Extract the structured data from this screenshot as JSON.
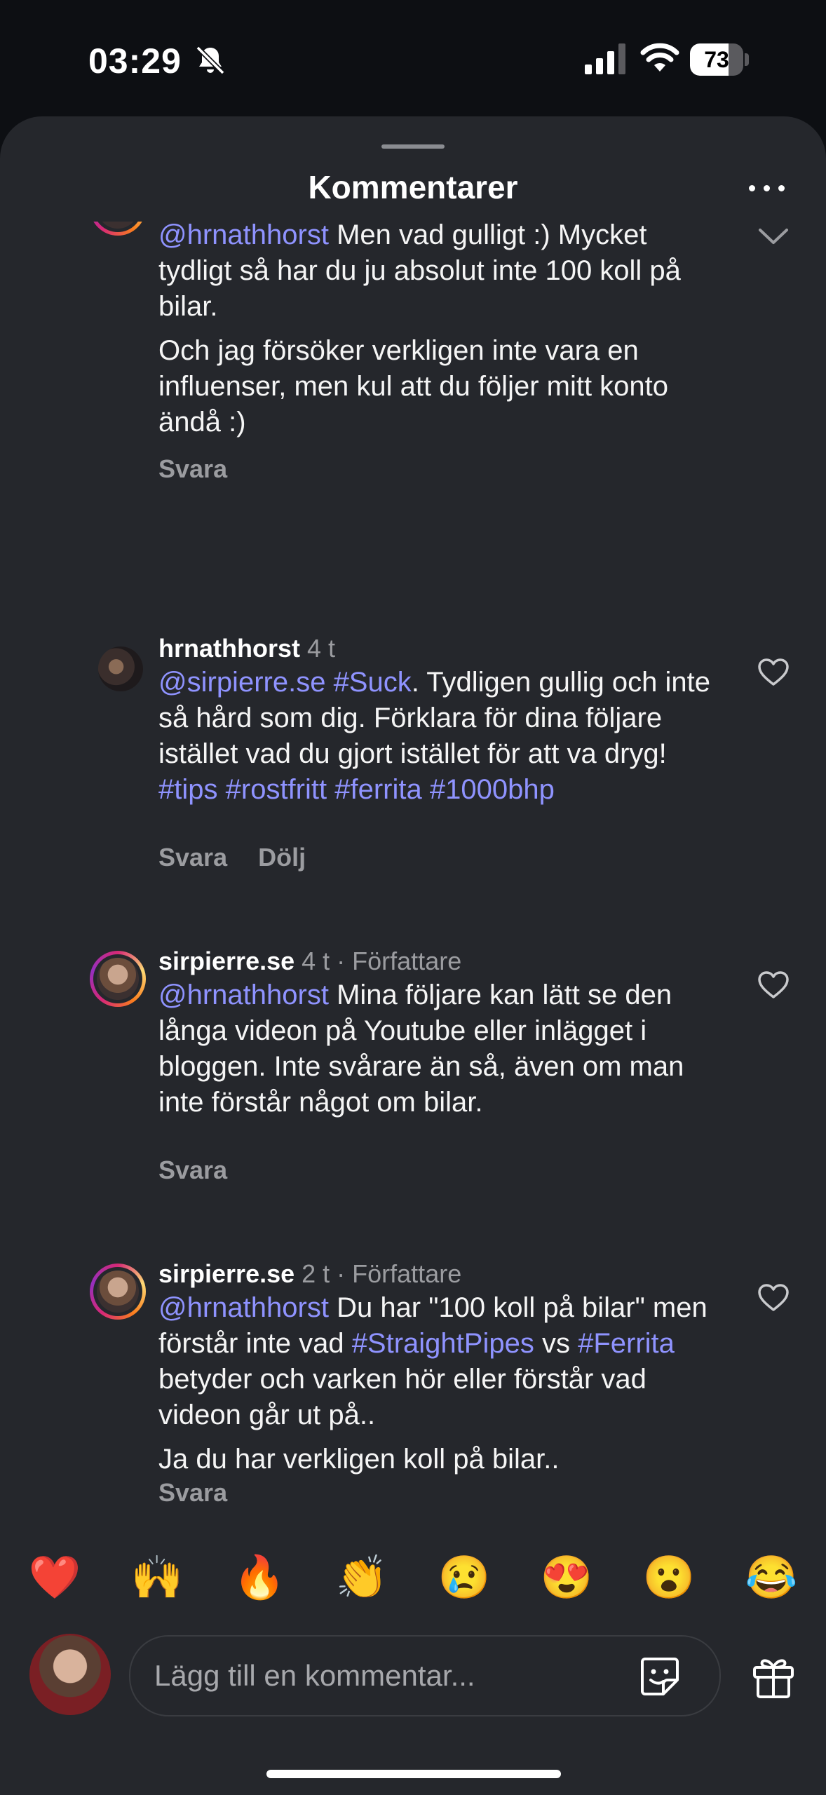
{
  "status_bar": {
    "time": "03:29",
    "battery": "73",
    "battery_level": 0.73
  },
  "sheet": {
    "title": "Kommentarer"
  },
  "comments": [
    {
      "partial": true,
      "paragraphs": [
        [
          {
            "t": "@hrnathhorst",
            "link": true
          },
          {
            "t": " Men vad gulligt :) Mycket tydligt så har du ju absolut inte 100 koll på bilar.",
            "link": false
          }
        ],
        [
          {
            "t": "Och jag försöker verkligen inte vara en influenser, men kul att du följer mitt konto ändå :)",
            "link": false
          }
        ]
      ],
      "actions": [
        "Svara"
      ]
    },
    {
      "username": "hrnathhorst",
      "meta": " 4 t",
      "paragraphs": [
        [
          {
            "t": "@sirpierre.se",
            "link": true
          },
          {
            "t": " ",
            "link": false
          },
          {
            "t": "#Suck",
            "link": true
          },
          {
            "t": ". Tydligen gullig och inte så hård som dig. Förklara för dina följare istället vad du gjort istället för att va dryg! ",
            "link": false
          },
          {
            "t": "#tips",
            "link": true
          },
          {
            "t": " ",
            "link": false
          },
          {
            "t": "#rostfritt",
            "link": true
          },
          {
            "t": " ",
            "link": false
          },
          {
            "t": "#ferrita",
            "link": true
          },
          {
            "t": " ",
            "link": false
          },
          {
            "t": "#1000bhp",
            "link": true
          }
        ]
      ],
      "actions": [
        "Svara",
        "Dölj"
      ]
    },
    {
      "username": "sirpierre.se",
      "meta": " 4 t · Författare",
      "paragraphs": [
        [
          {
            "t": "@hrnathhorst",
            "link": true
          },
          {
            "t": " Mina följare kan lätt se den långa videon på Youtube eller inlägget i bloggen. Inte svårare än så, även om man inte förstår något om bilar.",
            "link": false
          }
        ]
      ],
      "actions": [
        "Svara"
      ]
    },
    {
      "username": "sirpierre.se",
      "meta": " 2 t · Författare",
      "paragraphs": [
        [
          {
            "t": "@hrnathhorst",
            "link": true
          },
          {
            "t": " Du har \"100 koll på bilar\" men förstår inte vad ",
            "link": false
          },
          {
            "t": "#StraightPipes",
            "link": true
          },
          {
            "t": " vs ",
            "link": false
          },
          {
            "t": "#Ferrita",
            "link": true
          },
          {
            "t": " betyder och varken hör eller förstår vad videon går ut på..",
            "link": false
          }
        ],
        [
          {
            "t": "Ja du har verkligen koll på bilar..",
            "link": false
          }
        ]
      ],
      "actions": [
        "Svara"
      ]
    }
  ],
  "emoji_bar": [
    "❤️",
    "🙌",
    "🔥",
    "👏",
    "😢",
    "😍",
    "😮",
    "😂"
  ],
  "composer": {
    "placeholder": "Lägg till en kommentar..."
  },
  "icons": {
    "status": [
      "bell-slash-icon",
      "cellular-signal-icon",
      "wifi-icon",
      "battery-icon"
    ],
    "sheet": [
      "more-options-icon",
      "heart-icon",
      "chevron-down-icon",
      "sticker-icon",
      "gift-icon"
    ]
  },
  "colors": {
    "link": "#8f93ff",
    "sheet_background": "#25272c",
    "secondary_text": "#9b9ca0"
  }
}
